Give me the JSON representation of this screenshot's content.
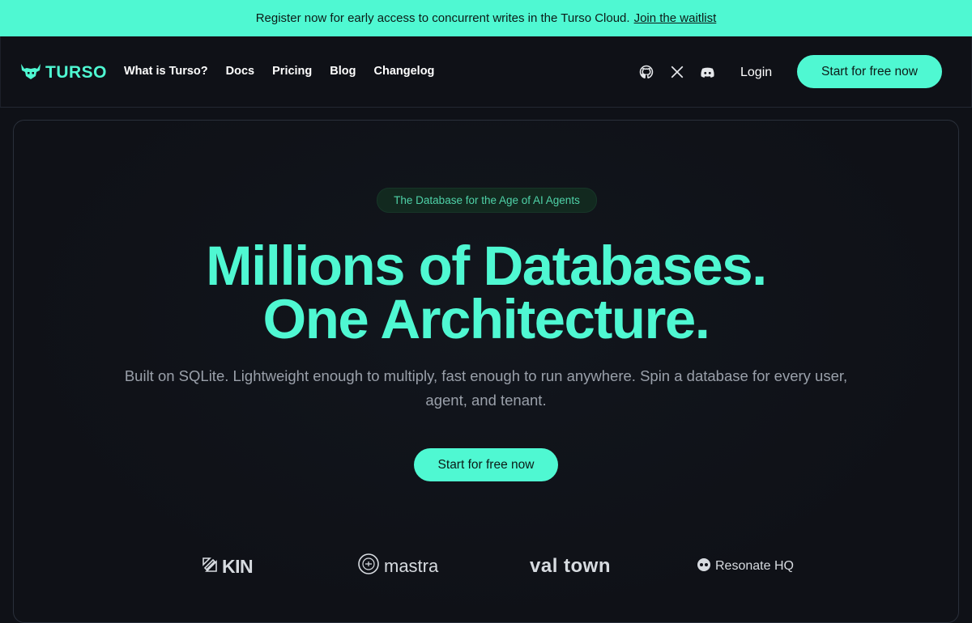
{
  "banner": {
    "text": "Register now for early access to concurrent writes in the Turso Cloud.",
    "link": "Join the waitlist"
  },
  "nav": {
    "logo": "TURSO",
    "links": [
      "What is Turso?",
      "Docs",
      "Pricing",
      "Blog",
      "Changelog"
    ],
    "icons": [
      "github-icon",
      "x-icon",
      "discord-icon"
    ],
    "login": "Login",
    "cta": "Start for free now"
  },
  "hero": {
    "tag": "The Database for the Age of AI Agents",
    "headline_line1": "Millions of Databases.",
    "headline_line2": "One Architecture.",
    "subtitle": "Built on SQLite. Lightweight enough to multiply, fast enough to run anywhere. Spin a database for every user, agent, and tenant.",
    "cta": "Start for free now"
  },
  "logos": [
    "KIN",
    "mastra",
    "val town",
    "Resonate HQ"
  ],
  "colors": {
    "accent": "#4ff8d2",
    "background": "#0f1117",
    "tag_bg": "#12291f"
  }
}
